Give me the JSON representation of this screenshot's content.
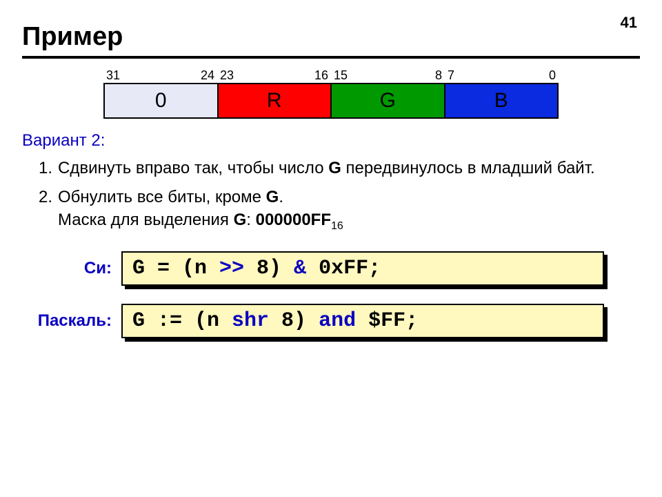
{
  "page_number": "41",
  "title": "Пример",
  "bits": {
    "pairs": [
      {
        "hi": "31",
        "lo": "24"
      },
      {
        "hi": "23",
        "lo": "16"
      },
      {
        "hi": "15",
        "lo": "8"
      },
      {
        "hi": "7",
        "lo": "0"
      }
    ],
    "cells": {
      "zero": "0",
      "r": "R",
      "g": "G",
      "b": "B"
    }
  },
  "variant_label": "Вариант 2:",
  "steps": {
    "s1_num": "1.",
    "s1_pre": "Сдвинуть вправо так, чтобы число ",
    "s1_g": "G",
    "s1_post": " передвинулось в младший байт.",
    "s2_num": "2.",
    "s2_line1_pre": "Обнулить все биты, кроме ",
    "s2_line1_g": "G",
    "s2_line1_post": ".",
    "s2_line2_pre": "Маска для выделения ",
    "s2_line2_g": "G",
    "s2_line2_mid": ": ",
    "s2_line2_mask": "000000FF",
    "s2_line2_sub": "16"
  },
  "code": {
    "c_label": "Си:",
    "pascal_label": "Паскаль:",
    "c": {
      "p1": "G = (n ",
      "op": ">>",
      "p2": " 8) ",
      "amp": "&",
      "p3": " 0xFF;"
    },
    "pascal": {
      "p1": "G := (n ",
      "shr": "shr",
      "p2": " 8) ",
      "and": "and",
      "p3": " $FF;"
    }
  }
}
